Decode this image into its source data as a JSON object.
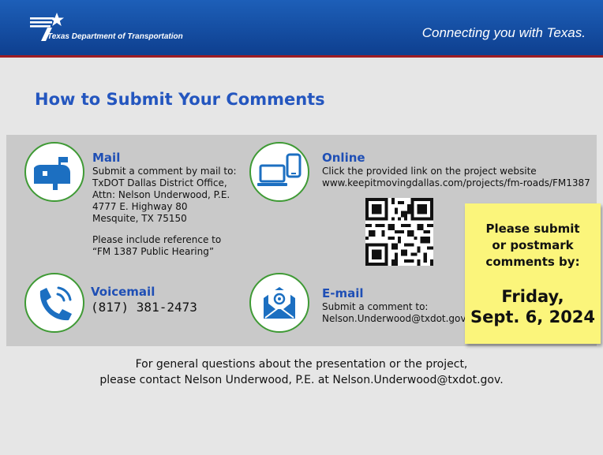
{
  "header": {
    "org_name": "Texas Department of Transportation",
    "tagline": "Connecting you with Texas."
  },
  "title": "How to Submit Your Comments",
  "mail": {
    "heading": "Mail",
    "lines": [
      "Submit a comment by mail to:",
      "TxDOT Dallas District Office,",
      "Attn: Nelson Underwood, P.E.",
      "4777 E. Highway 80",
      "Mesquite, TX 75150"
    ],
    "reference": [
      "Please include reference to",
      "“FM 1387 Public Hearing”"
    ]
  },
  "online": {
    "heading": "Online",
    "lines": [
      "Click the provided link on the project website",
      "www.keepitmovingdallas.com/projects/fm-roads/FM1387"
    ]
  },
  "voicemail": {
    "heading": "Voicemail",
    "phone": "(817) 381-2473"
  },
  "email": {
    "heading": "E-mail",
    "lines": [
      "Submit a comment to:",
      "Nelson.Underwood@txdot.gov"
    ]
  },
  "deadline": {
    "lines": [
      "Please submit",
      "or postmark",
      "comments by:"
    ],
    "date_lines": [
      "Friday,",
      "Sept. 6, 2024"
    ]
  },
  "footer": {
    "lines": [
      "For general questions about the presentation or the project,",
      "please contact Nelson Underwood, P.E. at Nelson.Underwood@txdot.gov."
    ]
  },
  "colors": {
    "header_blue": "#0e3f8f",
    "accent_red": "#9c1d24",
    "heading_blue": "#1f4fb5",
    "icon_blue": "#1c6fc1",
    "circle_border_green": "#3f9a35",
    "note_yellow": "#fbf57b"
  },
  "icons": [
    "star-icon",
    "mailbox-icon",
    "devices-icon",
    "phone-icon",
    "envelope-icon",
    "qr-code"
  ]
}
